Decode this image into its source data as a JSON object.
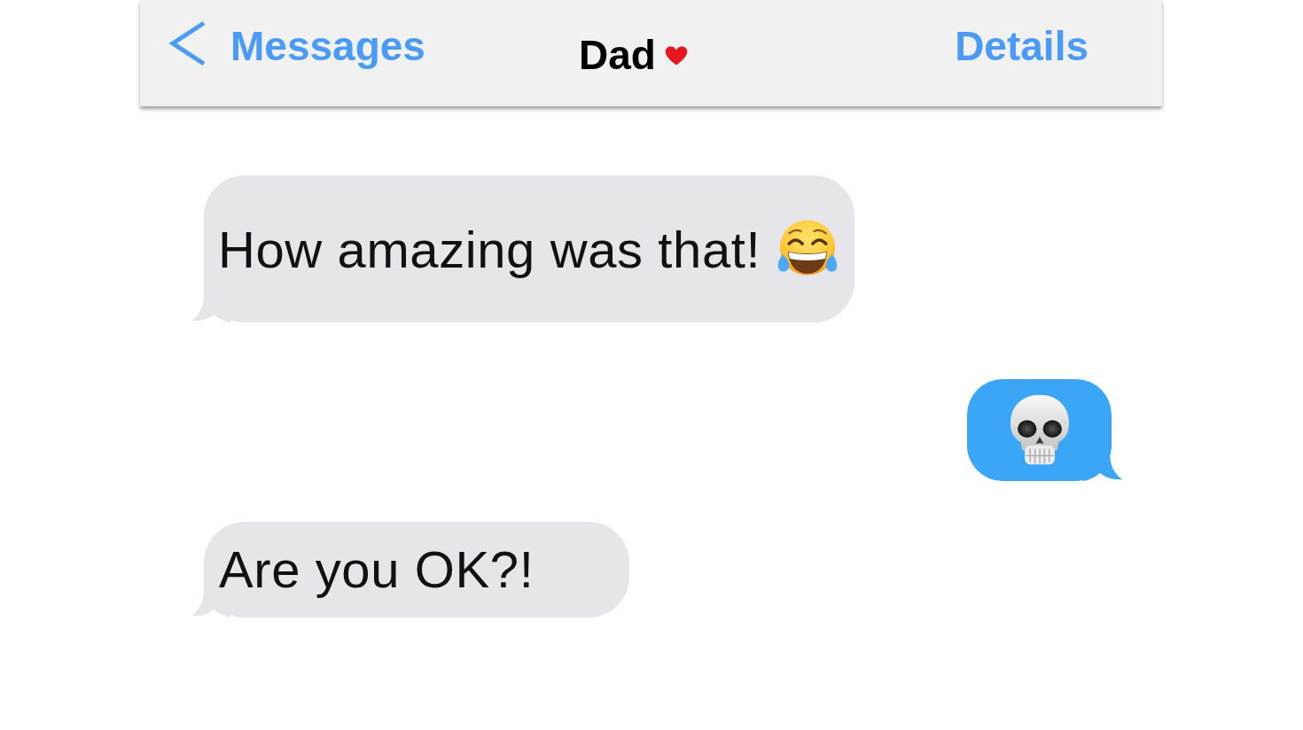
{
  "navigation_bar": {
    "back_label": "Messages",
    "title": "Dad",
    "action_label": "Details"
  },
  "messages": [
    {
      "kind": "text_emoji",
      "outgoing": false,
      "text": "How amazing was that!"
    },
    {
      "kind": "emoji",
      "outgoing": true
    },
    {
      "kind": "text",
      "outgoing": false,
      "text": "Are you OK?!"
    }
  ]
}
